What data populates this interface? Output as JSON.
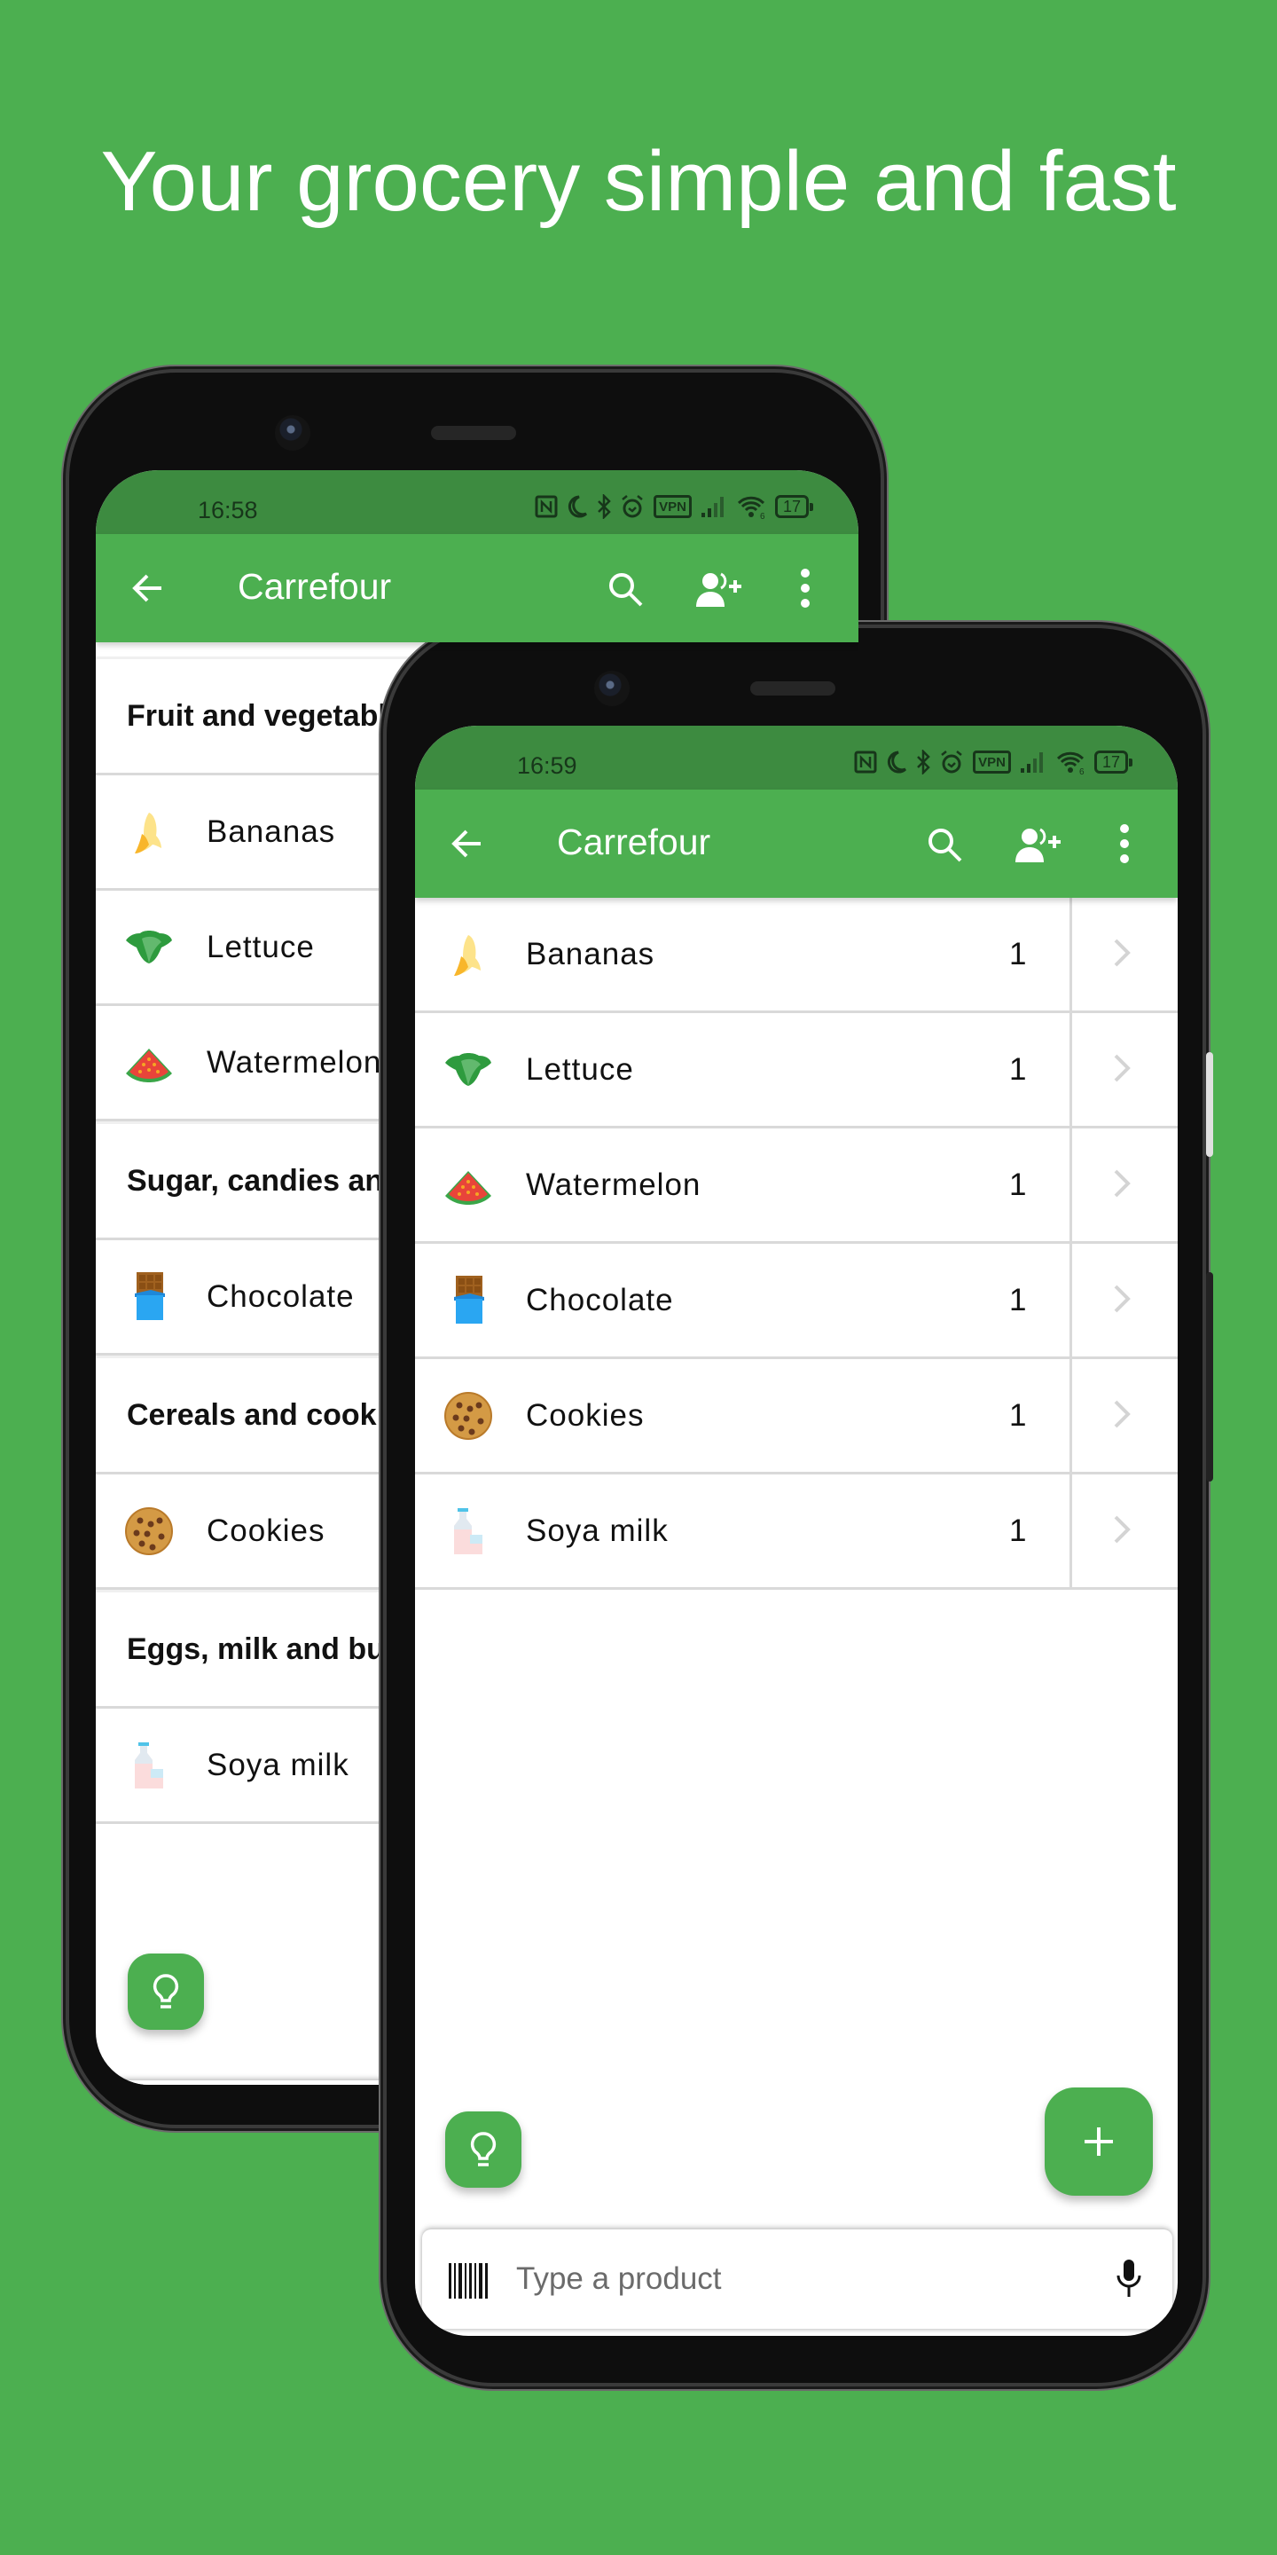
{
  "headline": "Your grocery simple and fast",
  "colors": {
    "background": "#4caf50",
    "appbar": "#4caf50",
    "statusbar": "#3d8b40",
    "divider": "#d9d9d9",
    "fab": "#4caf50"
  },
  "back_phone": {
    "status": {
      "time": "16:58",
      "icons": [
        "nfc-icon",
        "moon-icon",
        "bluetooth-icon",
        "alarm-icon",
        "vpn-icon",
        "signal-icon",
        "wifi-icon",
        "battery-icon"
      ],
      "vpn_label": "VPN",
      "wifi_label": "6",
      "battery": "17"
    },
    "appbar": {
      "title": "Carrefour",
      "actions": [
        "back-arrow-icon",
        "search-icon",
        "add-user-icon",
        "more-vert-icon"
      ]
    },
    "sections": [
      {
        "category": "Fruit and vegetables",
        "items": [
          {
            "name": "Bananas",
            "icon": "banana"
          },
          {
            "name": "Lettuce",
            "icon": "lettuce"
          },
          {
            "name": "Watermelon",
            "icon": "watermelon"
          }
        ]
      },
      {
        "category": "Sugar, candies and chocolate",
        "items": [
          {
            "name": "Chocolate",
            "icon": "chocolate"
          }
        ]
      },
      {
        "category": "Cereals and cookies",
        "items": [
          {
            "name": "Cookies",
            "icon": "cookie"
          }
        ]
      },
      {
        "category": "Eggs, milk and butter",
        "items": [
          {
            "name": "Soya milk",
            "icon": "milk"
          }
        ]
      }
    ],
    "input_placeholder": "Type a product"
  },
  "front_phone": {
    "status": {
      "time": "16:59",
      "vpn_label": "VPN",
      "wifi_label": "6",
      "battery": "17"
    },
    "appbar": {
      "title": "Carrefour"
    },
    "items": [
      {
        "name": "Bananas",
        "qty": "1",
        "icon": "banana"
      },
      {
        "name": "Lettuce",
        "qty": "1",
        "icon": "lettuce"
      },
      {
        "name": "Watermelon",
        "qty": "1",
        "icon": "watermelon"
      },
      {
        "name": "Chocolate",
        "qty": "1",
        "icon": "chocolate"
      },
      {
        "name": "Cookies",
        "qty": "1",
        "icon": "cookie"
      },
      {
        "name": "Soya milk",
        "qty": "1",
        "icon": "milk"
      }
    ],
    "input_placeholder": "Type a product"
  }
}
